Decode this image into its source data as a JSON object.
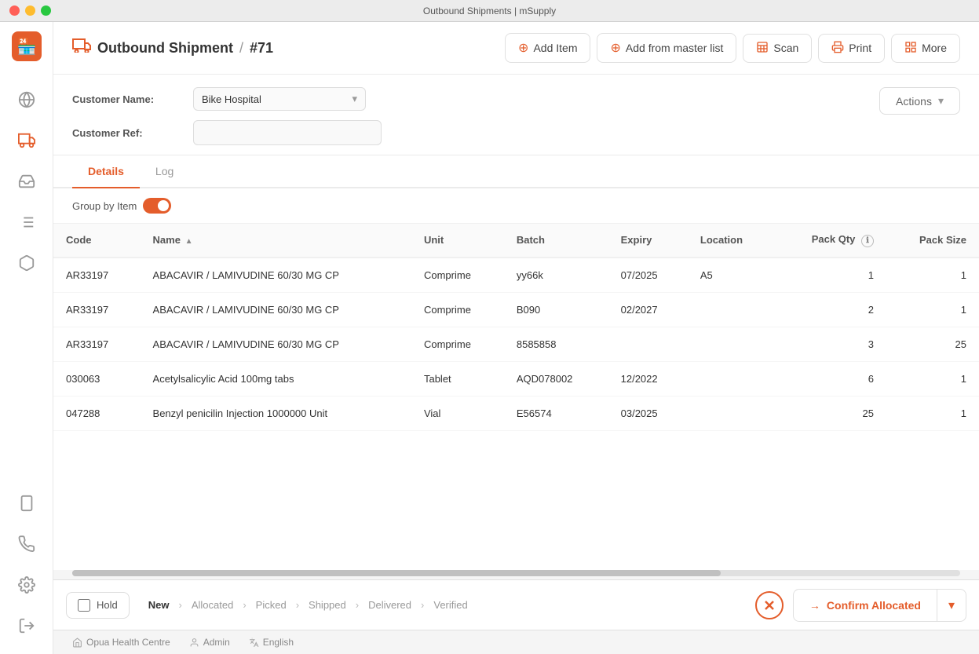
{
  "window": {
    "title": "Outbound Shipments | mSupply"
  },
  "header": {
    "page_title": "Outbound Shipment",
    "separator": "/",
    "shipment_number": "#71"
  },
  "toolbar": {
    "add_item_label": "Add Item",
    "add_from_master_label": "Add from master list",
    "scan_label": "Scan",
    "print_label": "Print",
    "more_label": "More"
  },
  "form": {
    "customer_name_label": "Customer Name:",
    "customer_name_value": "Bike Hospital",
    "customer_ref_label": "Customer Ref:",
    "customer_ref_value": ""
  },
  "actions_button": "Actions",
  "tabs": [
    {
      "id": "details",
      "label": "Details",
      "active": true
    },
    {
      "id": "log",
      "label": "Log",
      "active": false
    }
  ],
  "table": {
    "group_by_label": "Group by Item",
    "columns": [
      {
        "key": "code",
        "label": "Code",
        "sortable": false
      },
      {
        "key": "name",
        "label": "Name",
        "sortable": true
      },
      {
        "key": "unit",
        "label": "Unit",
        "sortable": false
      },
      {
        "key": "batch",
        "label": "Batch",
        "sortable": false
      },
      {
        "key": "expiry",
        "label": "Expiry",
        "sortable": false
      },
      {
        "key": "location",
        "label": "Location",
        "sortable": false
      },
      {
        "key": "pack_qty",
        "label": "Pack Qty",
        "sortable": false,
        "align": "right",
        "info": true
      },
      {
        "key": "pack_size",
        "label": "Pack Size",
        "sortable": false,
        "align": "right"
      }
    ],
    "rows": [
      {
        "code": "AR33197",
        "name": "ABACAVIR / LAMIVUDINE 60/30 MG CP",
        "unit": "Comprime",
        "batch": "yy66k",
        "expiry": "07/2025",
        "location": "A5",
        "pack_qty": "1",
        "pack_size": "1"
      },
      {
        "code": "AR33197",
        "name": "ABACAVIR / LAMIVUDINE 60/30 MG CP",
        "unit": "Comprime",
        "batch": "B090",
        "expiry": "02/2027",
        "location": "",
        "pack_qty": "2",
        "pack_size": "1"
      },
      {
        "code": "AR33197",
        "name": "ABACAVIR / LAMIVUDINE 60/30 MG CP",
        "unit": "Comprime",
        "batch": "8585858",
        "expiry": "",
        "location": "",
        "pack_qty": "3",
        "pack_size": "25"
      },
      {
        "code": "030063",
        "name": "Acetylsalicylic Acid 100mg tabs",
        "unit": "Tablet",
        "batch": "AQD078002",
        "expiry": "12/2022",
        "location": "",
        "pack_qty": "6",
        "pack_size": "1"
      },
      {
        "code": "047288",
        "name": "Benzyl penicilin Injection 1000000 Unit",
        "unit": "Vial",
        "batch": "E56574",
        "expiry": "03/2025",
        "location": "",
        "pack_qty": "25",
        "pack_size": "1"
      }
    ]
  },
  "bottom_bar": {
    "hold_label": "Hold",
    "status_steps": [
      {
        "label": "New",
        "active": true
      },
      {
        "label": "Allocated",
        "active": false
      },
      {
        "label": "Picked",
        "active": false
      },
      {
        "label": "Shipped",
        "active": false
      },
      {
        "label": "Delivered",
        "active": false
      },
      {
        "label": "Verified",
        "active": false
      }
    ],
    "confirm_allocated_label": "Confirm Allocated"
  },
  "footer": {
    "location": "Opua Health Centre",
    "user": "Admin",
    "language": "English"
  },
  "sidebar": {
    "items": [
      {
        "id": "globe",
        "icon": "🌐",
        "label": "Dashboard"
      },
      {
        "id": "truck",
        "icon": "🚚",
        "label": "Outbound Shipments",
        "active": true
      },
      {
        "id": "inbox",
        "icon": "📥",
        "label": "Inbound Shipments"
      },
      {
        "id": "list",
        "icon": "☰",
        "label": "Inventory"
      },
      {
        "id": "box",
        "icon": "📦",
        "label": "Items"
      }
    ],
    "bottom_items": [
      {
        "id": "device",
        "icon": "📱",
        "label": "Device"
      },
      {
        "id": "radio",
        "icon": "📡",
        "label": "Notifications"
      },
      {
        "id": "settings",
        "icon": "⚙️",
        "label": "Settings"
      },
      {
        "id": "power",
        "icon": "⏻",
        "label": "Logout"
      }
    ]
  },
  "colors": {
    "brand": "#e45d2b",
    "border": "#e0e0e0",
    "bg_light": "#f5f5f5"
  }
}
